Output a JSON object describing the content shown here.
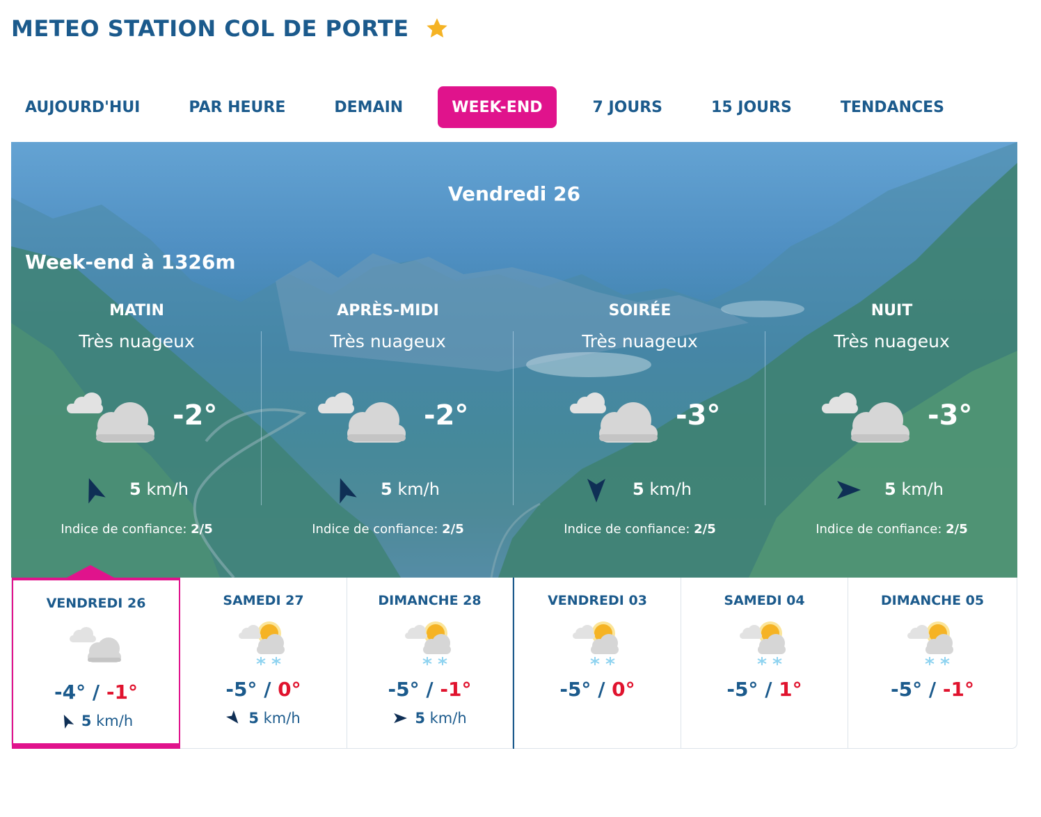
{
  "header": {
    "title": "METEO STATION COL DE PORTE",
    "favorite_icon": "star-icon",
    "favorite_color": "#f5b324"
  },
  "tabs": [
    {
      "label": "AUJOURD'HUI",
      "active": false
    },
    {
      "label": "PAR HEURE",
      "active": false
    },
    {
      "label": "DEMAIN",
      "active": false
    },
    {
      "label": "WEEK-END",
      "active": true
    },
    {
      "label": "7 JOURS",
      "active": false
    },
    {
      "label": "15 JOURS",
      "active": false
    },
    {
      "label": "TENDANCES",
      "active": false
    }
  ],
  "hero": {
    "date": "Vendredi 26",
    "altitude_label": "Week-end à 1326m",
    "periods": [
      {
        "name": "MATIN",
        "condition": "Très nuageux",
        "icon": "cloudy-icon",
        "temp": "-2°",
        "wind_icon": "wind-arrow-icon",
        "wind_speed": "5",
        "wind_unit": "km/h",
        "confidence_label": "Indice de confiance:",
        "confidence_value": "2/5"
      },
      {
        "name": "APRÈS-MIDI",
        "condition": "Très nuageux",
        "icon": "cloudy-icon",
        "temp": "-2°",
        "wind_icon": "wind-arrow-icon",
        "wind_speed": "5",
        "wind_unit": "km/h",
        "confidence_label": "Indice de confiance:",
        "confidence_value": "2/5"
      },
      {
        "name": "SOIRÉE",
        "condition": "Très nuageux",
        "icon": "cloudy-icon",
        "temp": "-3°",
        "wind_icon": "wind-arrow-icon",
        "wind_speed": "5",
        "wind_unit": "km/h",
        "confidence_label": "Indice de confiance:",
        "confidence_value": "2/5"
      },
      {
        "name": "NUIT",
        "condition": "Très nuageux",
        "icon": "cloudy-icon",
        "temp": "-3°",
        "wind_icon": "wind-arrow-icon",
        "wind_speed": "5",
        "wind_unit": "km/h",
        "confidence_label": "Indice de confiance:",
        "confidence_value": "2/5"
      }
    ]
  },
  "days": [
    {
      "name": "VENDREDI 26",
      "icon": "cloudy-icon",
      "tmin": "-4°",
      "tmax": "-1°",
      "wind_speed": "5",
      "wind_unit": "km/h",
      "active": true
    },
    {
      "name": "SAMEDI 27",
      "icon": "sun-cloud-snow-icon",
      "tmin": "-5°",
      "tmax": "0°",
      "wind_speed": "5",
      "wind_unit": "km/h",
      "active": false
    },
    {
      "name": "DIMANCHE 28",
      "icon": "sun-cloud-snow-icon",
      "tmin": "-5°",
      "tmax": "-1°",
      "wind_speed": "5",
      "wind_unit": "km/h",
      "active": false
    },
    {
      "name": "VENDREDI 03",
      "icon": "sun-cloud-snow-icon",
      "tmin": "-5°",
      "tmax": "0°",
      "active": false
    },
    {
      "name": "SAMEDI 04",
      "icon": "sun-cloud-snow-icon",
      "tmin": "-5°",
      "tmax": "1°",
      "active": false
    },
    {
      "name": "DIMANCHE 05",
      "icon": "sun-cloud-snow-icon",
      "tmin": "-5°",
      "tmax": "-1°",
      "active": false
    }
  ],
  "separator": "/",
  "colors": {
    "brand_blue": "#1b5a8c",
    "accent_pink": "#e0138c",
    "max_temp_red": "#e0132e"
  }
}
